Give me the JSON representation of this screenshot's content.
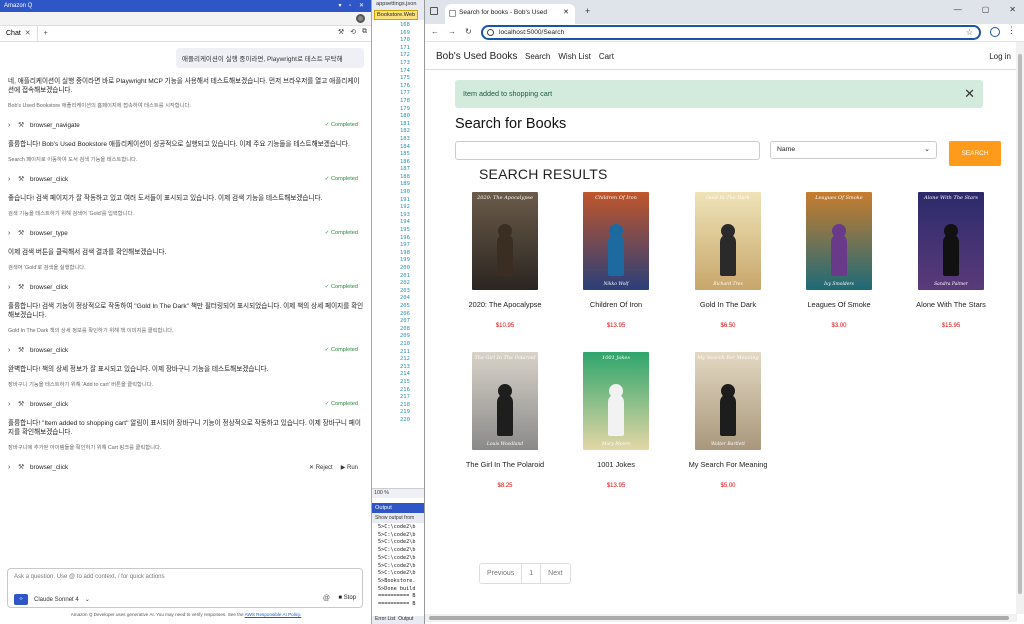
{
  "q_panel": {
    "title": "Amazon Q",
    "title_controls": "▾ ▫ ✕",
    "tab_label": "Chat",
    "user_prompt": "애플리케이션이 실행 중이라면, Playwright로 테스트 부탁해",
    "messages": [
      {
        "text": "네, 애플리케이션이 실행 중이라면 바로 Playwright MCP 기능을 사용해서 테스트해보겠습니다. 먼저 브라우저를 열고 애플리케이션에 접속해보겠습니다.",
        "sub": "Bob's Used Bookstore 애플리케이션의 홈페이지에 접속하여 테스트를 시작합니다.",
        "tool": "browser_navigate",
        "status": "Completed"
      },
      {
        "text": "훌륭합니다! Bob's Used Bookstore 애플리케이션이 성공적으로 실행되고 있습니다. 이제 주요 기능들을 테스트해보겠습니다.",
        "sub": "Search 페이지로 이동하여 도서 검색 기능을 테스트합니다.",
        "tool": "browser_click",
        "status": "Completed"
      },
      {
        "text": "좋습니다! 검색 페이지가 잘 작동하고 있고 여러 도서들이 표시되고 있습니다. 이제 검색 기능을 테스트해보겠습니다.",
        "sub": "검색 기능을 테스트하기 위해 검색어 'Gold'를 입력합니다.",
        "tool": "browser_type",
        "status": "Completed"
      },
      {
        "text": "이제 검색 버튼을 클릭해서 검색 결과를 확인해보겠습니다.",
        "sub": "검색어 'Gold'로 검색을 실행합니다.",
        "tool": "browser_click",
        "status": "Completed"
      },
      {
        "text": "훌륭합니다! 검색 기능이 정상적으로 작동하여 \"Gold In The Dark\" 책만 필터링되어 표시되었습니다. 이제 책의 상세 페이지를 확인해보겠습니다.",
        "sub": "Gold In The Dark 책의 상세 정보를 확인하기 위해 책 이미지를 클릭합니다.",
        "tool": "browser_click",
        "status": "Completed"
      },
      {
        "text": "완벽합니다! 책의 상세 정보가 잘 표시되고 있습니다. 이제 장바구니 기능을 테스트해보겠습니다.",
        "sub": "장바구니 기능을 테스트하기 위해 'Add to cart' 버튼을 클릭합니다.",
        "tool": "browser_click",
        "status": "Completed"
      },
      {
        "text": "훌륭합니다! \"Item added to shopping cart\" 알림이 표시되어 장바구니 기능이 정상적으로 작동하고 있습니다. 이제 장바구니 페이지를 확인해보겠습니다.",
        "sub": "장바구니에 추가된 아이템들을 확인하기 위해 Cart 링크를 클릭합니다.",
        "tool": "browser_click",
        "status": ""
      }
    ],
    "reject_label": "Reject",
    "run_label": "Run",
    "input_placeholder": "Ask a question. Use @ to add context, / for quick actions",
    "model_label": "Claude Sonnet 4",
    "stop_label": "Stop",
    "footer_text": "Amazon Q Developer uses generative AI. You may need to verify responses. See the",
    "footer_link": "AWS Responsible AI Policy."
  },
  "vs": {
    "tab1": "appsettings.json",
    "tab2": "Bookstore.Web",
    "line_numbers": [
      "168",
      "169",
      "170",
      "171",
      "172",
      "173",
      "174",
      "175",
      "176",
      "177",
      "178",
      "179",
      "180",
      "181",
      "182",
      "183",
      "184",
      "185",
      "186",
      "187",
      "188",
      "189",
      "190",
      "191",
      "192",
      "193",
      "194",
      "195",
      "196",
      "197",
      "198",
      "199",
      "200",
      "201",
      "202",
      "203",
      "204",
      "205",
      "206",
      "207",
      "208",
      "209",
      "210",
      "211",
      "212",
      "213",
      "214",
      "215",
      "216",
      "217",
      "218",
      "219",
      "220"
    ],
    "zoom": "100 %",
    "output_title": "Output",
    "output_sub": "Show output from",
    "output_lines": [
      "5>C:\\code2\\b",
      "5>C:\\code2\\b",
      "5>C:\\code2\\b",
      "5>C:\\code2\\b",
      "5>C:\\code2\\b",
      "5>C:\\code2\\b",
      "5>C:\\code2\\b",
      "5>Bookstore.",
      "5>Done build",
      "========== B",
      "========== B"
    ],
    "bottom_tabs": [
      "Error List",
      "Output"
    ]
  },
  "browser": {
    "tab_title": "Search for books - Bob's Used",
    "url": "localhost:5000/Search",
    "site": {
      "brand": "Bob's Used Books",
      "nav": [
        "Search",
        "Wish List",
        "Cart"
      ],
      "login": "Log in",
      "alert": "Item added to shopping cart",
      "heading": "Search for Books",
      "sort_selected": "Name",
      "search_button": "SEARCH",
      "results_heading": "SEARCH RESULTS",
      "books": [
        {
          "title": "2020: The Apocalypse",
          "price": "$10.95",
          "cover_text": "2020: The Apocalypse",
          "cover_author": "",
          "bg": "#6b5b4a",
          "bg2": "#2a2520",
          "fig": "#3a2e22"
        },
        {
          "title": "Children Of Iron",
          "price": "$13.95",
          "cover_text": "Children Of Iron",
          "cover_author": "Nikko Wolf",
          "bg": "#c0562b",
          "bg2": "#2a3f7a",
          "fig": "#1d6aa0"
        },
        {
          "title": "Gold In The Dark",
          "price": "$6.50",
          "cover_text": "Gold In The Dark",
          "cover_author": "Richard Tres",
          "bg": "#efe3b8",
          "bg2": "#c8a66a",
          "fig": "#2a2a2a"
        },
        {
          "title": "Leagues Of Smoke",
          "price": "$3.00",
          "cover_text": "Leagues Of Smoke",
          "cover_author": "Ivy Smolders",
          "bg": "#c87d2e",
          "bg2": "#1e6a78",
          "fig": "#6a3a8a"
        },
        {
          "title": "Alone With The Stars",
          "price": "$15.95",
          "cover_text": "Alone With The Stars",
          "cover_author": "Sandra Palmer",
          "bg": "#2b2a6b",
          "bg2": "#5a3a7a",
          "fig": "#111111"
        },
        {
          "title": "The Girl In The Polaroid",
          "price": "$8.25",
          "cover_text": "The Girl In The Polaroid",
          "cover_author": "Louis Woodland",
          "bg": "#d8d2c8",
          "bg2": "#8a8a8a",
          "fig": "#1e1e1e"
        },
        {
          "title": "1001 Jokes",
          "price": "$13.95",
          "cover_text": "1001 Jokes",
          "cover_author": "Mary Moore",
          "bg": "#2ea56b",
          "bg2": "#e4d7a6",
          "fig": "#f2f2f2"
        },
        {
          "title": "My Search For Meaning",
          "price": "$5.00",
          "cover_text": "My Search For Meaning",
          "cover_author": "Walter Bartlett",
          "bg": "#e3d8c2",
          "bg2": "#a8977b",
          "fig": "#1d1d1d"
        }
      ],
      "pager": [
        "Previous",
        "1",
        "Next"
      ]
    }
  },
  "colors": {
    "accent": "#2e56c7",
    "search_button": "#ff9a1a",
    "alert_bg": "#d3ebdd",
    "price": "#dd0000",
    "completed": "#2a8a3e"
  }
}
